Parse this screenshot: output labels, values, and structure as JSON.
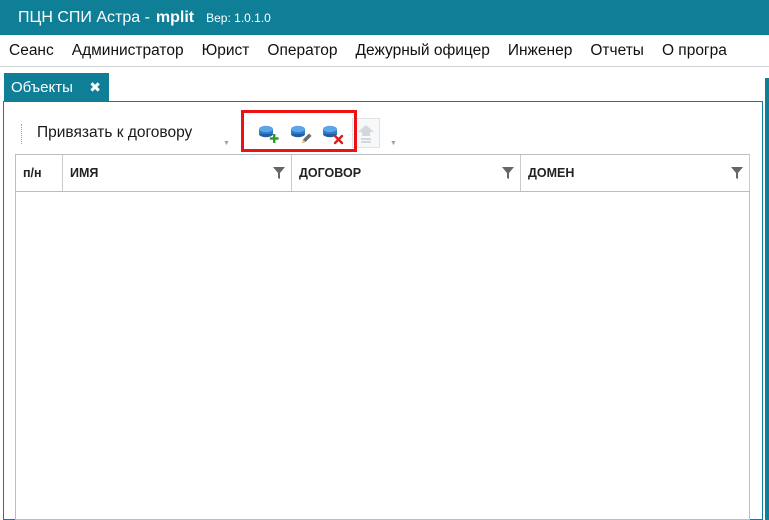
{
  "app": {
    "title": "ПЦН СПИ Астра -",
    "user": "mplit",
    "version": "Вер: 1.0.1.0"
  },
  "menu": [
    "Сеанс",
    "Администратор",
    "Юрист",
    "Оператор",
    "Дежурный офицер",
    "Инженер",
    "Отчеты",
    "О програ"
  ],
  "tab": {
    "label": "Объекты",
    "close_icon": "close-icon"
  },
  "toolbar": {
    "bind_label": "Привязать к договору",
    "buttons": [
      "add-object-icon",
      "edit-object-icon",
      "delete-object-icon",
      "disabled-upload-icon"
    ]
  },
  "grid": {
    "columns": [
      "п/н",
      "ИМЯ",
      "ДОГОВОР",
      "ДОМЕН"
    ],
    "rows": []
  },
  "colors": {
    "accent": "#0f7f97",
    "highlight": "#ee1111"
  }
}
